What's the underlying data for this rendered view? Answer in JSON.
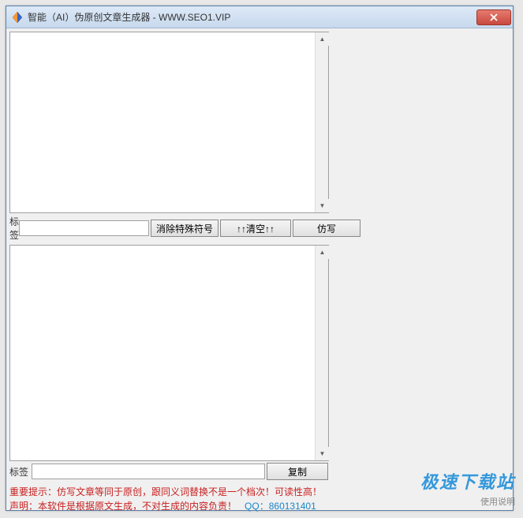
{
  "window": {
    "title": "智能（AI）伪原创文章生成器 - WWW.SEO1.VIP"
  },
  "input_section": {
    "tag_label": "标签",
    "tag_value": "",
    "btn_remove_special": "消除特殊符号",
    "btn_clear": "↑↑清空↑↑",
    "btn_rewrite": "仿写"
  },
  "output_section": {
    "tag_label": "标签",
    "tag_value": "",
    "btn_copy": "复制"
  },
  "warning": {
    "line1_prefix": "重要提示：",
    "line1_text": "仿写文章等同于原创，跟同义词替换不是一个档次！可读性高！",
    "line2_prefix": "声明：",
    "line2_text": "本软件是根据原文生成，不对生成的内容负责！",
    "qq_label": "QQ：",
    "qq_number": "860131401"
  },
  "watermark": {
    "main": "极速下载站",
    "sub": "使用说明"
  }
}
